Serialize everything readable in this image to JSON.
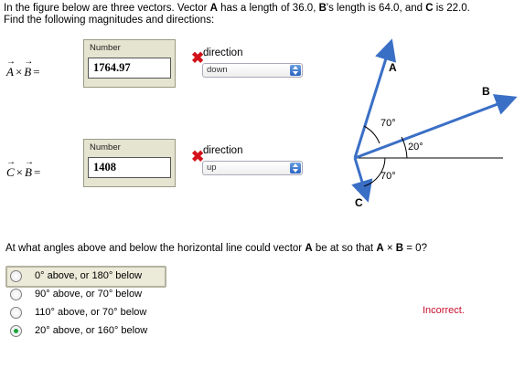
{
  "problem": {
    "line1_parts": [
      "In the figure below are three vectors. Vector ",
      "A",
      " has a length of 36.0, ",
      "B",
      "'s length is 64.0, and ",
      "C",
      " is 22.0."
    ],
    "line2": "Find the following magnitudes and directions:"
  },
  "part1": {
    "vec_a": "A",
    "vec_b": "B",
    "times": "×",
    "equals": "=",
    "number_label": "Number",
    "number_value": "1764.97",
    "direction_label": "direction",
    "direction_value": "down",
    "status": "incorrect"
  },
  "part2": {
    "vec_a": "C",
    "vec_b": "B",
    "times": "×",
    "equals": "=",
    "number_label": "Number",
    "number_value": "1408",
    "direction_label": "direction",
    "direction_value": "up",
    "status": "incorrect"
  },
  "figure": {
    "label_a": "A",
    "label_b": "B",
    "label_c": "C",
    "angle_a": "70°",
    "angle_b": "20°",
    "angle_c": "70°",
    "arrow_color": "#3a6fc6"
  },
  "question": {
    "parts": [
      "At what angles above and below the horizontal line could vector ",
      "A",
      " be at so that ",
      "A",
      " × ",
      "B",
      " = 0?"
    ],
    "choices": [
      {
        "label": "0° above, or 180° below",
        "selected": false
      },
      {
        "label": "90° above, or 70° below",
        "selected": false
      },
      {
        "label": "110° above, or 70° below",
        "selected": false
      },
      {
        "label": "20° above, or 160° below",
        "selected": true
      }
    ]
  },
  "feedback": "Incorrect.",
  "colors": {
    "incorrect": "#c8102e",
    "selected_radio": "#1aa33a",
    "box_bg": "#e4e4d0"
  }
}
